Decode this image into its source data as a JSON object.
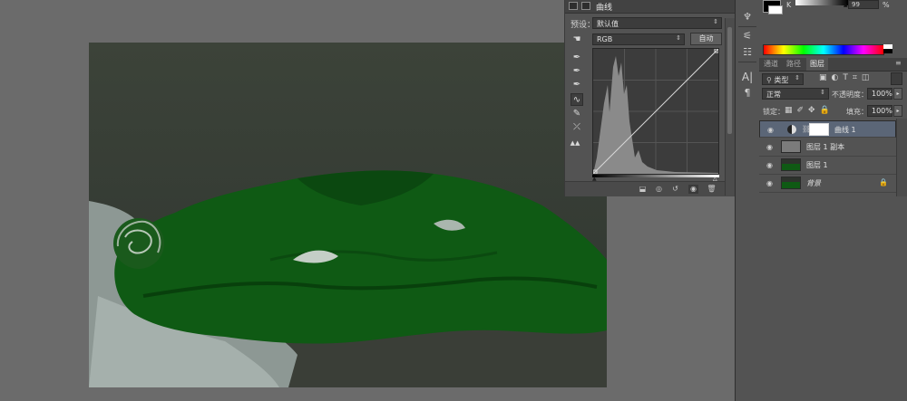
{
  "colors": {
    "workspace": "#6b6b6b",
    "panel": "#535353",
    "selected_layer": "#5b6677",
    "fabric_green": "#0f5a14"
  },
  "color_panel": {
    "channel_label": "K",
    "value": "99",
    "unit": "%"
  },
  "properties_panel": {
    "title": "曲线",
    "preset_label": "预设：",
    "preset_value": "默认值",
    "channel_value": "RGB",
    "auto_button": "自动",
    "tools": [
      "pointer-hand-icon",
      "black-eyedropper-icon",
      "gray-eyedropper-icon",
      "white-eyedropper-icon",
      "curve-edit-icon",
      "pencil-icon",
      "smooth-icon",
      "clipping-warning-icon"
    ]
  },
  "layers_panel": {
    "tabs": [
      "通道",
      "路径",
      "图层"
    ],
    "active_tab": "图层",
    "filter_kind": "类型",
    "blend_mode": "正常",
    "opacity_label": "不透明度：",
    "opacity_value": "100%",
    "lock_label": "锁定：",
    "fill_label": "填充：",
    "fill_value": "100%",
    "layers": [
      {
        "name": "曲线 1",
        "selected": true,
        "type": "adjustment"
      },
      {
        "name": "图层 1 副本",
        "selected": false,
        "type": "gray"
      },
      {
        "name": "图层 1",
        "selected": false,
        "type": "photo"
      },
      {
        "name": "背景",
        "selected": false,
        "type": "photo",
        "locked": true
      }
    ]
  }
}
